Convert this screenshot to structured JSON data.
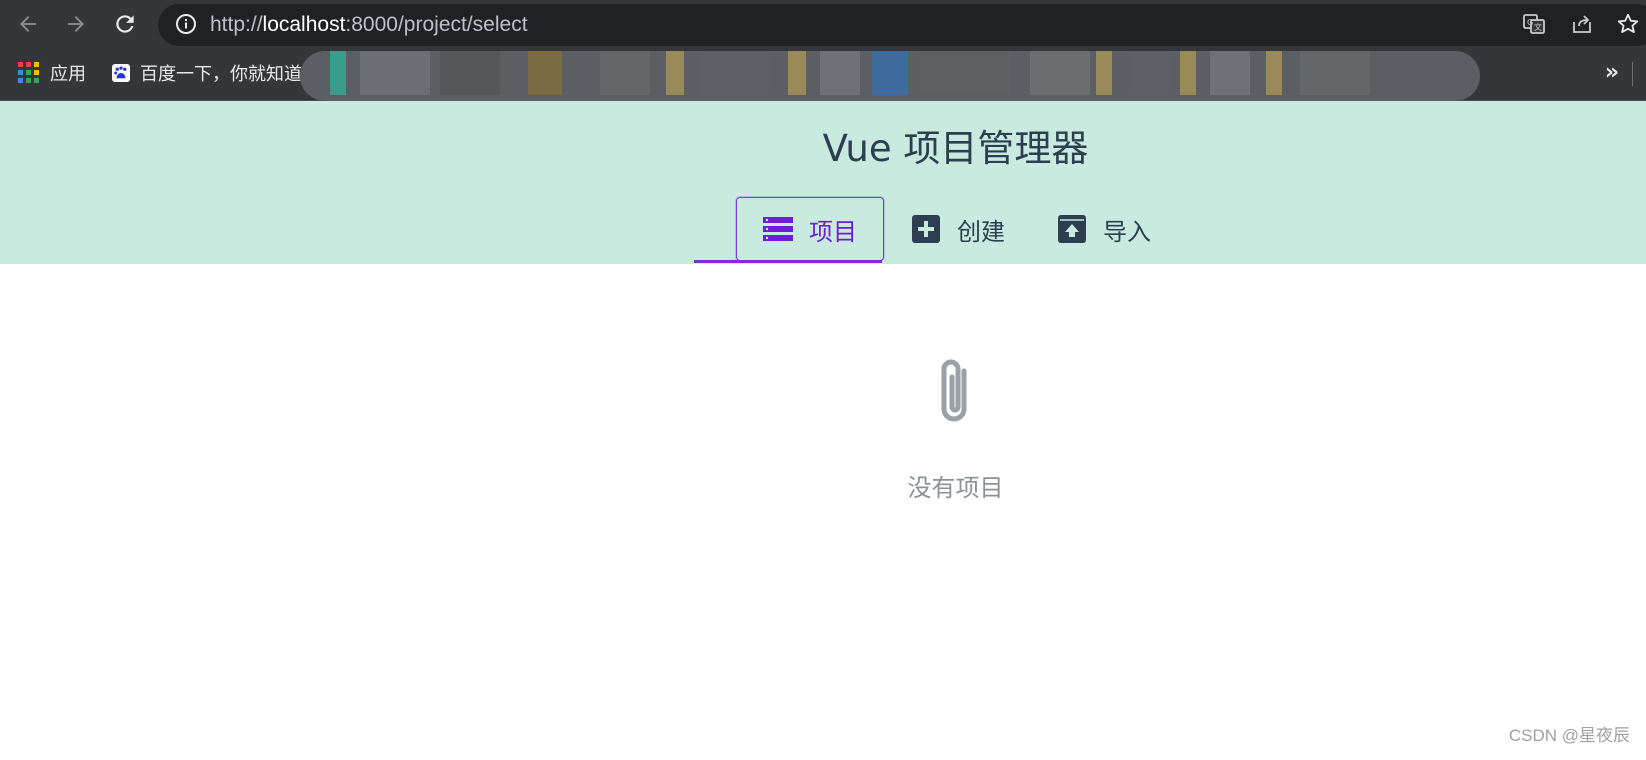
{
  "browser": {
    "url_prefix": "http://",
    "url_host": "localhost",
    "url_rest": ":8000/project/select",
    "back_icon": "arrow-left-icon",
    "forward_icon": "arrow-right-icon",
    "reload_icon": "reload-icon",
    "info_icon": "info-circle-icon",
    "translate_icon": "translate-icon",
    "share_icon": "share-icon",
    "bookmark_star_icon": "star-icon"
  },
  "bookmarks": {
    "apps_label": "应用",
    "baidu_label": "百度一下，你就知道",
    "overflow_label": "»"
  },
  "app": {
    "title": "Vue 项目管理器",
    "tabs": [
      {
        "label": "项目",
        "icon": "list-icon",
        "active": true
      },
      {
        "label": "创建",
        "icon": "plus-box-icon",
        "active": false
      },
      {
        "label": "导入",
        "icon": "upload-box-icon",
        "active": false
      }
    ],
    "empty_state": {
      "icon": "paperclip-icon",
      "text": "没有项目"
    },
    "colors": {
      "header_bg": "#c8eadf",
      "accent": "#7b2fd8",
      "text": "#2c3e50"
    }
  },
  "watermark": "CSDN @星夜辰"
}
